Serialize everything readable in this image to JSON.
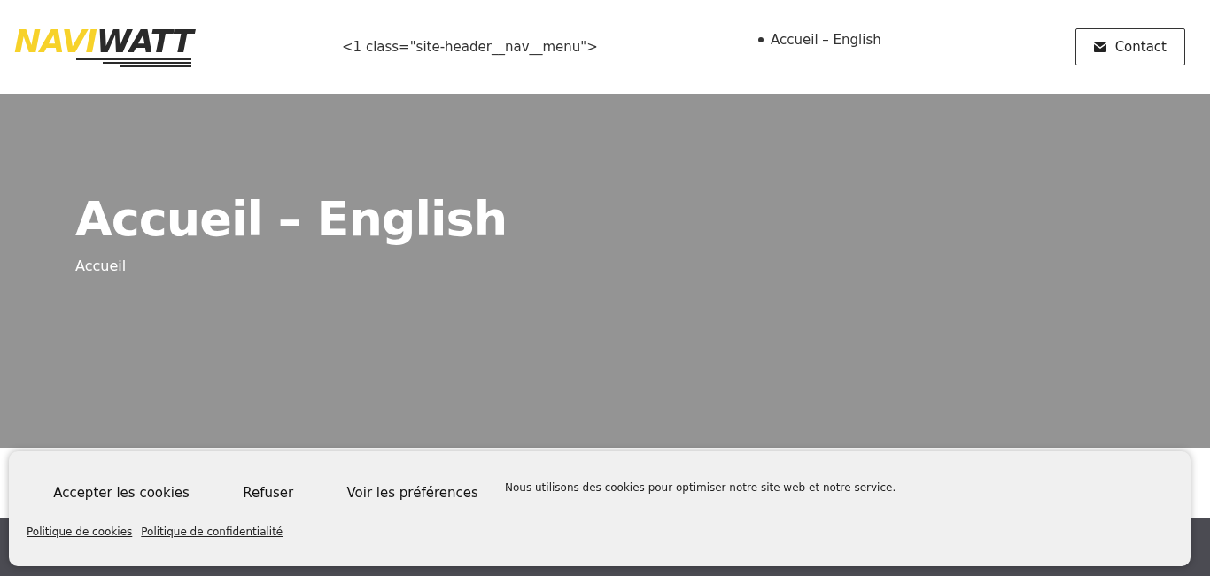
{
  "header": {
    "logo": {
      "first": "NAVI",
      "second": "WATT"
    },
    "nav_menu_text": "<1 class=\"site-header__nav__menu\">",
    "nav_items": [
      "Accueil – English"
    ],
    "contact_button": "Contact"
  },
  "hero": {
    "title": "Accueil – English",
    "breadcrumb": "Accueil"
  },
  "cookie_banner": {
    "message": "Nous utilisons des cookies pour optimiser notre site web et notre service.",
    "buttons": [
      "Accepter les cookies",
      "Refuser",
      "Voir les préférences"
    ],
    "links": [
      "Politique de cookies",
      "Politique de confidentialité"
    ]
  }
}
